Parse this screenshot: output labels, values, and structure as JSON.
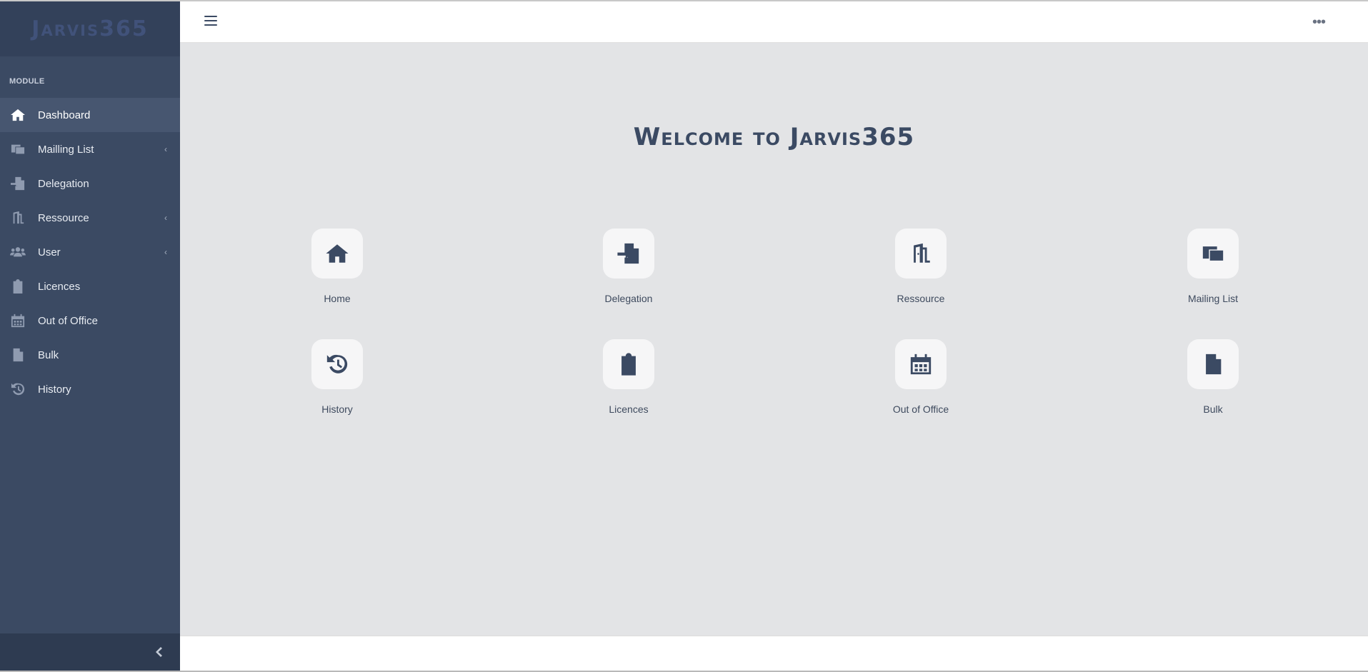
{
  "brand": {
    "name": "Jarvis365"
  },
  "sidebar": {
    "section_label": "MODULE",
    "items": [
      {
        "label": "Dashboard",
        "icon": "home-icon",
        "active": true,
        "has_submenu": false
      },
      {
        "label": "Mailling List",
        "icon": "mailing-list-icon",
        "active": false,
        "has_submenu": true
      },
      {
        "label": "Delegation",
        "icon": "delegation-icon",
        "active": false,
        "has_submenu": false
      },
      {
        "label": "Ressource",
        "icon": "door-icon",
        "active": false,
        "has_submenu": true
      },
      {
        "label": "User",
        "icon": "users-icon",
        "active": false,
        "has_submenu": true
      },
      {
        "label": "Licences",
        "icon": "clipboard-icon",
        "active": false,
        "has_submenu": false
      },
      {
        "label": "Out of Office",
        "icon": "calendar-icon",
        "active": false,
        "has_submenu": false
      },
      {
        "label": "Bulk",
        "icon": "file-upload-icon",
        "active": false,
        "has_submenu": false
      },
      {
        "label": "History",
        "icon": "history-icon",
        "active": false,
        "has_submenu": false
      }
    ],
    "submenu_glyph": "‹",
    "collapse_icon": "chevron-left-icon"
  },
  "topbar": {
    "menu_icon": "hamburger-icon",
    "more_icon": "more-icon",
    "more_glyph": "•••"
  },
  "main": {
    "welcome_title": "Welcome to Jarvis365",
    "tiles": [
      {
        "label": "Home",
        "icon": "home-icon"
      },
      {
        "label": "Delegation",
        "icon": "delegation-icon"
      },
      {
        "label": "Ressource",
        "icon": "door-icon"
      },
      {
        "label": "Mailing List",
        "icon": "mailing-list-icon"
      },
      {
        "label": "History",
        "icon": "history-icon"
      },
      {
        "label": "Licences",
        "icon": "clipboard-icon"
      },
      {
        "label": "Out of Office",
        "icon": "calendar-icon"
      },
      {
        "label": "Bulk",
        "icon": "file-upload-icon"
      }
    ]
  },
  "colors": {
    "sidebar_bg": "#3b4a63",
    "brand_bg": "#33415a",
    "active_item_bg": "#475670",
    "content_bg": "#e3e4e6",
    "accent": "#3b4a63"
  }
}
